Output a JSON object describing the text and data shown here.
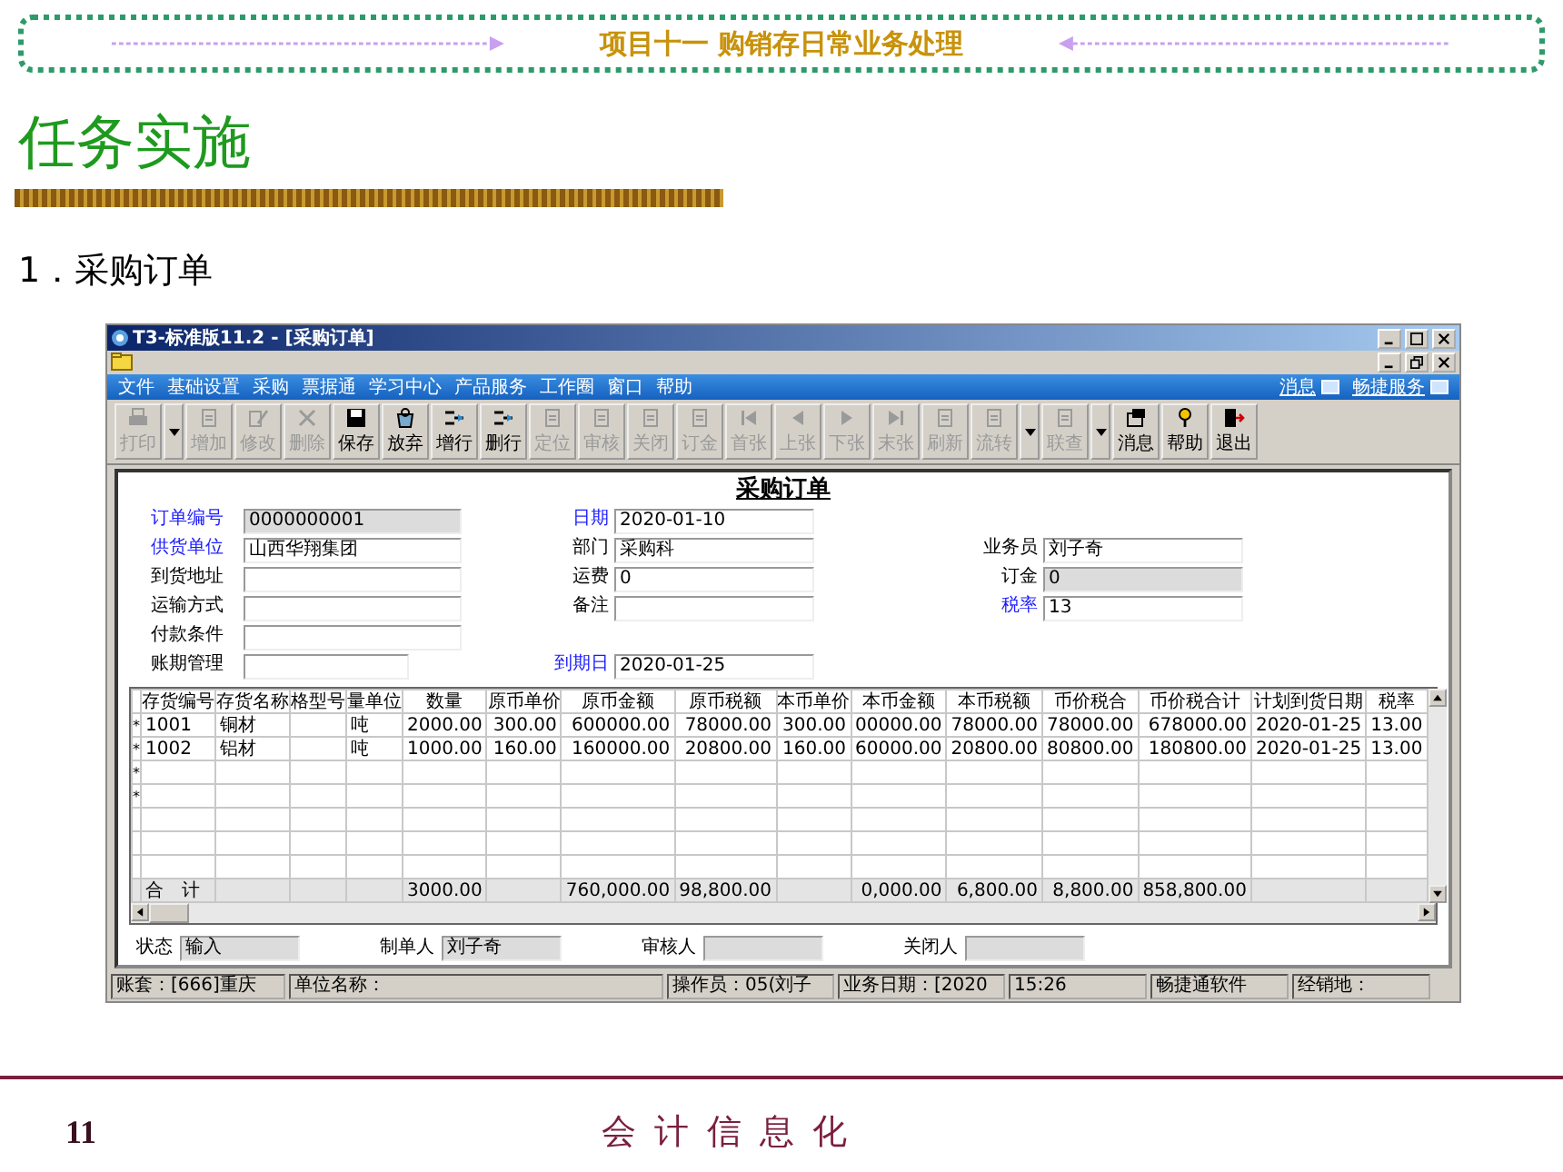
{
  "slide": {
    "banner_title": "项目十一  购销存日常业务处理",
    "heading": "任务实施",
    "subheading": "1．采购订单",
    "page_number": "11",
    "footer_title": "会 计 信 息 化"
  },
  "app_window": {
    "title": "T3-标准版11.2 - [采购订单]",
    "menu": [
      "文件",
      "基础设置",
      "采购",
      "票据通",
      "学习中心",
      "产品服务",
      "工作圈",
      "窗口",
      "帮助"
    ],
    "menu_links": [
      "消息",
      "畅捷服务"
    ],
    "toolbar": [
      {
        "label": "打印",
        "disabled": true,
        "dropdown": true
      },
      {
        "label": "增加",
        "disabled": true,
        "dropdown": false
      },
      {
        "label": "修改",
        "disabled": true,
        "dropdown": false
      },
      {
        "label": "删除",
        "disabled": true,
        "dropdown": false
      },
      {
        "label": "保存",
        "disabled": false,
        "dropdown": false
      },
      {
        "label": "放弃",
        "disabled": false,
        "dropdown": false
      },
      {
        "label": "增行",
        "disabled": false,
        "dropdown": false
      },
      {
        "label": "删行",
        "disabled": false,
        "dropdown": false
      },
      {
        "label": "定位",
        "disabled": true,
        "dropdown": false
      },
      {
        "label": "审核",
        "disabled": true,
        "dropdown": false
      },
      {
        "label": "关闭",
        "disabled": true,
        "dropdown": false
      },
      {
        "label": "订金",
        "disabled": true,
        "dropdown": false
      },
      {
        "label": "首张",
        "disabled": true,
        "dropdown": false
      },
      {
        "label": "上张",
        "disabled": true,
        "dropdown": false
      },
      {
        "label": "下张",
        "disabled": true,
        "dropdown": false
      },
      {
        "label": "末张",
        "disabled": true,
        "dropdown": false
      },
      {
        "label": "刷新",
        "disabled": true,
        "dropdown": false
      },
      {
        "label": "流转",
        "disabled": true,
        "dropdown": true
      },
      {
        "label": "联查",
        "disabled": true,
        "dropdown": true
      },
      {
        "label": "消息",
        "disabled": false,
        "dropdown": false
      },
      {
        "label": "帮助",
        "disabled": false,
        "dropdown": false
      },
      {
        "label": "退出",
        "disabled": false,
        "dropdown": false
      }
    ],
    "form": {
      "title": "采购订单",
      "rows": [
        [
          {
            "label": "订单编号",
            "value": "0000000001",
            "required": true,
            "readonly": true
          },
          {
            "label": "日期",
            "value": "2020-01-10",
            "required": true,
            "readonly": false
          },
          null
        ],
        [
          {
            "label": "供货单位",
            "value": "山西华翔集团",
            "required": true,
            "readonly": false
          },
          {
            "label": "部门",
            "value": "采购科",
            "required": false,
            "readonly": false
          },
          {
            "label": "业务员",
            "value": "刘子奇",
            "required": false,
            "readonly": false
          }
        ],
        [
          {
            "label": "到货地址",
            "required": false,
            "readonly": false
          },
          {
            "label": "运费",
            "value": "0",
            "required": false,
            "readonly": false
          },
          {
            "label": "订金",
            "value": "0",
            "required": false,
            "readonly": true
          }
        ],
        [
          {
            "label": "运输方式",
            "required": false,
            "readonly": false
          },
          {
            "label": "备注",
            "required": false,
            "readonly": false
          },
          {
            "label": "税率",
            "value": "13",
            "required": true,
            "readonly": false
          }
        ],
        [
          {
            "label": "付款条件",
            "required": false,
            "readonly": false
          },
          null,
          null
        ],
        [
          {
            "label": "账期管理",
            "required": false,
            "readonly": false
          },
          {
            "label": "到期日",
            "value": "2020-01-25",
            "required": true,
            "readonly": false
          },
          null
        ]
      ],
      "table": {
        "columns": [
          "存货编号",
          "存货名称",
          "格型号",
          "量单位",
          "数量",
          "原币单价",
          "原币金额",
          "原币税额",
          "本币单价",
          "本币金额",
          "本币税额",
          "币价税合",
          "币价税合计",
          "计划到货日期",
          "税率"
        ],
        "rows": [
          {
            "marker": "*",
            "cells": [
              "1001",
              "铜材",
              null,
              "吨",
              "2000.00",
              "300.00",
              "600000.00",
              "78000.00",
              "300.00",
              "00000.00",
              "78000.00",
              "78000.00",
              "678000.00",
              "2020-01-25",
              "13.00"
            ]
          },
          {
            "marker": "*",
            "cells": [
              "1002",
              "铝材",
              null,
              "吨",
              "1000.00",
              "160.00",
              "160000.00",
              "20800.00",
              "160.00",
              "60000.00",
              "20800.00",
              "80800.00",
              "180800.00",
              "2020-01-25",
              "13.00"
            ]
          },
          {
            "marker": "*"
          },
          {
            "marker": "*"
          }
        ],
        "total": {
          "label": "合　计",
          "quantity": "3000.00",
          "original_amount": "760,000.00",
          "original_tax": "98,800.00",
          "local_amount": "0,000.00",
          "local_tax": "6,800.00",
          "column_12": "8,800.00",
          "column_13": "858,800.00"
        }
      },
      "footer_fields": [
        {
          "label": "状态",
          "value": "输入"
        },
        {
          "label": "制单人",
          "value": "刘子奇"
        },
        {
          "label": "审核人"
        },
        {
          "label": "关闭人"
        }
      ]
    },
    "status_bar": [
      "账套：[666]重庆",
      "单位名称：",
      "操作员：05(刘子",
      "业务日期：[2020",
      "15:26",
      "畅捷通软件",
      "经销地："
    ]
  }
}
